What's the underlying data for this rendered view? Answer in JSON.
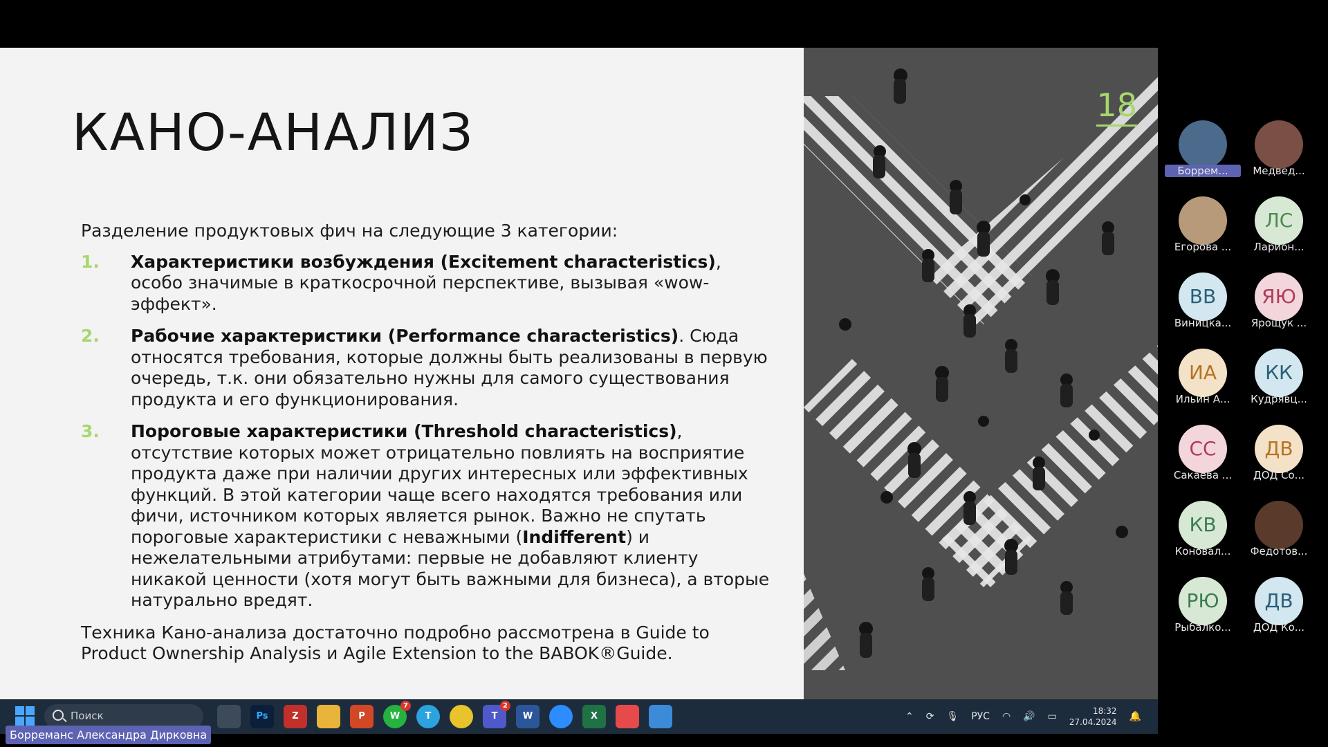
{
  "slide": {
    "title": "КАНО-АНАЛИЗ",
    "number": "18",
    "intro": "Разделение продуктовых фич на следующие 3 категории:",
    "items": [
      {
        "num": "1.",
        "bold": "Характеристики возбуждения (Excitement characteristics)",
        "text": ", особо значимые в краткосрочной перспективе, вызывая «wow-эффект»."
      },
      {
        "num": "2.",
        "bold": "Рабочие характеристики (Performance characteristics)",
        "text": ". Сюда относятся требования, которые должны быть реализованы в первую очередь, т.к. они обязательно нужны для самого существования продукта и его функционирования."
      },
      {
        "num": "3.",
        "bold": "Пороговые характеристики (Threshold characteristics)",
        "text": ", отсутствие которых может отрицательно повлиять на восприятие продукта даже при наличии других интересных или эффективных функций. В этой категории чаще всего находятся требования или фичи, источником которых является рынок. Важно не спутать пороговые характеристики с неважными (",
        "bold2": "Indifferent",
        "text2": ") и нежелательными атрибутами: первые не добавляют клиенту никакой ценности (хотя могут быть важными для бизнеса), а вторые натурально вредят."
      }
    ],
    "footer": "Техника Кано-анализа достаточно подробно рассмотрена в Guide to Product Ownership Analysis и Agile Extension to the BABOK®Guide."
  },
  "participants": [
    {
      "initials": "",
      "name": "Боррем...",
      "color": "#4b6a8c",
      "active": true
    },
    {
      "initials": "",
      "name": "Медвед...",
      "color": "#7a4f45"
    },
    {
      "initials": "",
      "name": "Егорова ...",
      "color": "#b79a7a"
    },
    {
      "initials": "ЛС",
      "name": "Ларион...",
      "color": "#d7e9d5",
      "text_color": "#4d8a4f"
    },
    {
      "initials": "ВВ",
      "name": "Виницка...",
      "color": "#d2e7ef",
      "text_color": "#2b5f79"
    },
    {
      "initials": "ЯЮ",
      "name": "Ярощук ...",
      "color": "#f2d6dc",
      "text_color": "#b03c57"
    },
    {
      "initials": "ИА",
      "name": "Ильин А...",
      "color": "#f4e2c8",
      "text_color": "#b67424"
    },
    {
      "initials": "КК",
      "name": "Кудрявц...",
      "color": "#d2e7ef",
      "text_color": "#2b5f79"
    },
    {
      "initials": "СС",
      "name": "Сакаева ...",
      "color": "#f2d6dc",
      "text_color": "#b03c57"
    },
    {
      "initials": "ДВ",
      "name": "ДОД Со...",
      "color": "#f4e2c8",
      "text_color": "#b67424"
    },
    {
      "initials": "КВ",
      "name": "Коновал...",
      "color": "#d7e9d5",
      "text_color": "#3d7c55"
    },
    {
      "initials": "",
      "name": "Федотов...",
      "color": "#5a3a2a"
    },
    {
      "initials": "РЮ",
      "name": "Рыбалко...",
      "color": "#d7e9d5",
      "text_color": "#3d7c55"
    },
    {
      "initials": "ДВ",
      "name": "ДОД Ко...",
      "color": "#d2e7ef",
      "text_color": "#2b5f79"
    }
  ],
  "taskbar": {
    "search_placeholder": "Поиск",
    "apps": [
      {
        "name": "task-view",
        "label": "",
        "color": "#3d4a5a"
      },
      {
        "name": "photoshop",
        "label": "Ps",
        "color": "#0b1e3a"
      },
      {
        "name": "app-red",
        "label": "Z",
        "color": "#c2302b"
      },
      {
        "name": "file-explorer",
        "label": "",
        "color": "#e8b43a"
      },
      {
        "name": "powerpoint",
        "label": "P",
        "color": "#d24726"
      },
      {
        "name": "whatsapp",
        "label": "W",
        "color": "#25b23f",
        "badge": "7"
      },
      {
        "name": "telegram",
        "label": "T",
        "color": "#2aa3de"
      },
      {
        "name": "chrome",
        "label": "",
        "color": "#e9c32b"
      },
      {
        "name": "teams",
        "label": "T",
        "color": "#5059c9",
        "badge": "2"
      },
      {
        "name": "word",
        "label": "W",
        "color": "#2b579a"
      },
      {
        "name": "zoom",
        "label": "",
        "color": "#2d8cff"
      },
      {
        "name": "excel",
        "label": "X",
        "color": "#1f7244"
      },
      {
        "name": "snipping",
        "label": "",
        "color": "#e64a4a"
      },
      {
        "name": "paint",
        "label": "",
        "color": "#3b8bd8"
      }
    ],
    "language": "РУС",
    "time": "18:32",
    "date": "27.04.2024"
  },
  "presenter_name": "Борреманс Александра Дирковна"
}
